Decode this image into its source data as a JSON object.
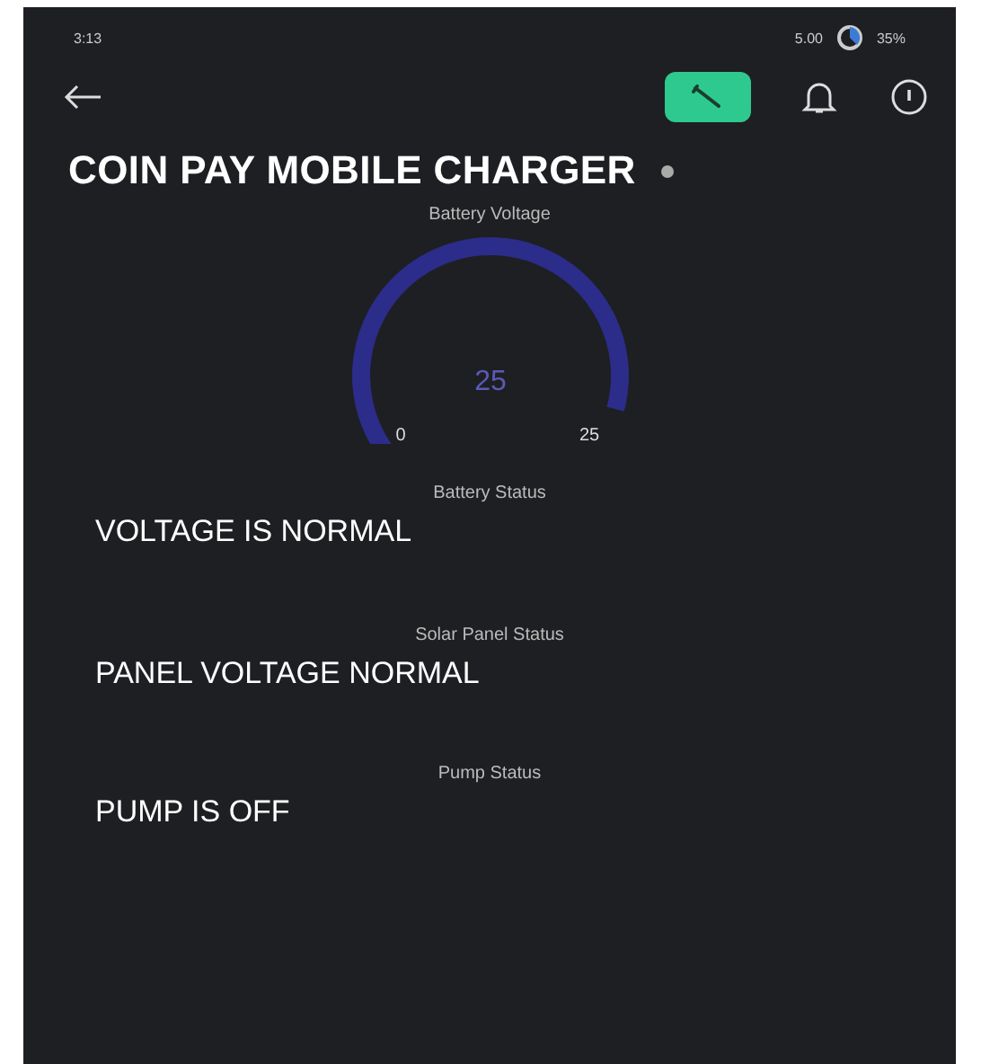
{
  "status_bar": {
    "time": "3:13",
    "speed": "5.00",
    "battery": "35%"
  },
  "app_bar": {
    "tool_selected": true
  },
  "title": "COIN PAY MOBILE CHARGER",
  "gauge": {
    "label": "Battery Voltage",
    "value": "25",
    "min": "0",
    "max": "25"
  },
  "sections": [
    {
      "label": "Battery Status",
      "value": "VOLTAGE IS NORMAL"
    },
    {
      "label": "Solar Panel Status",
      "value": "PANEL VOLTAGE NORMAL"
    },
    {
      "label": "Pump Status",
      "value": "PUMP IS OFF"
    }
  ]
}
